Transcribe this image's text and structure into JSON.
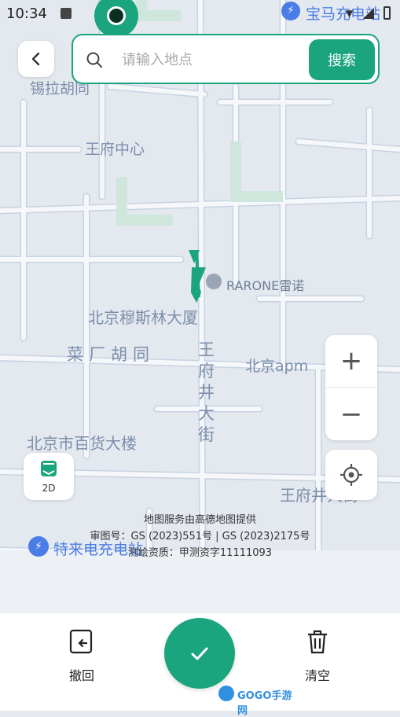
{
  "status_bar": {
    "time": "10:34"
  },
  "search": {
    "placeholder": "请输入地点",
    "value": "",
    "button_label": "搜索"
  },
  "map": {
    "labels": [
      {
        "key": "wangfu_center",
        "text": "王府中心"
      },
      {
        "key": "xila_hutong",
        "text": "锡拉胡同"
      },
      {
        "key": "muslim_building",
        "text": "北京穆斯林大厦"
      },
      {
        "key": "caichang_hutong",
        "text": "菜厂胡同"
      },
      {
        "key": "wangfujing",
        "text": "王府井大街"
      },
      {
        "key": "beijing_apm",
        "text": "北京apm"
      },
      {
        "key": "dept_store",
        "text": "北京市百货大楼"
      },
      {
        "key": "wangfujing_right",
        "text": "王府井大街"
      },
      {
        "key": "rarone",
        "text": "RARONE雷诺"
      },
      {
        "key": "baoma",
        "text": "宝马充电站"
      },
      {
        "key": "telai",
        "text": "特来电充电站"
      }
    ],
    "credits": {
      "line1": "地图服务由高德地图提供",
      "line2": "审图号：GS (2023)551号 | GS (2023)2175号",
      "line3": "测绘资质：甲测资字11111093"
    }
  },
  "controls": {
    "zoom_in": "+",
    "zoom_out": "−",
    "mode_label": "2D"
  },
  "toolbar": {
    "undo_label": "撤回",
    "clear_label": "清空"
  },
  "watermark": {
    "text": "GOGO手游网"
  },
  "colors": {
    "accent": "#1aa57e",
    "map_label": "#7c8eab",
    "road": "#f4f6fa",
    "route": "#1aa57e"
  }
}
